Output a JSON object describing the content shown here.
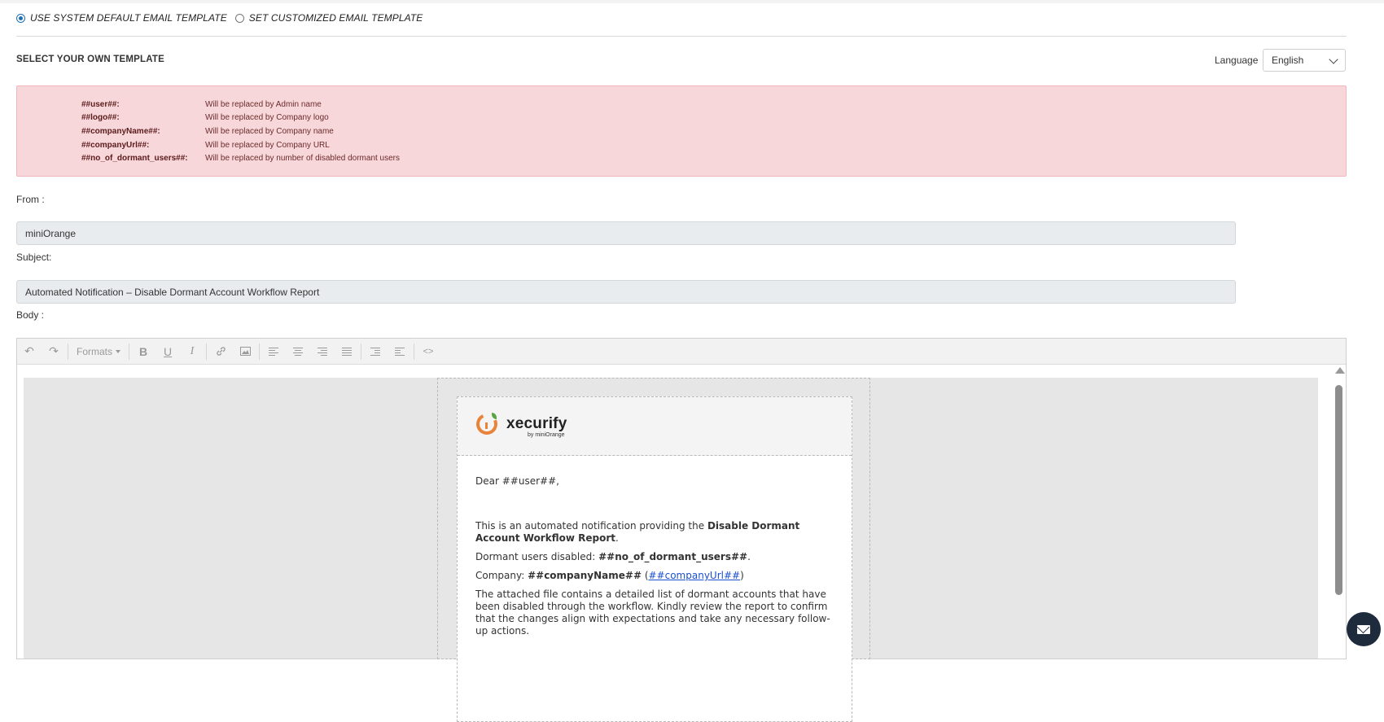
{
  "template_options": {
    "default_label": "USE SYSTEM DEFAULT EMAIL TEMPLATE",
    "custom_label": "SET CUSTOMIZED EMAIL TEMPLATE",
    "selected": "default"
  },
  "section": {
    "title": "SELECT YOUR OWN TEMPLATE",
    "language_label": "Language",
    "language_value": "English"
  },
  "placeholders": [
    {
      "key": "##user##:",
      "desc": "Will be replaced by Admin name"
    },
    {
      "key": "##logo##:",
      "desc": "Will be replaced by Company logo"
    },
    {
      "key": "##companyName##:",
      "desc": "Will be replaced by Company name"
    },
    {
      "key": "##companyUrl##:",
      "desc": "Will be replaced by Company URL"
    },
    {
      "key": "##no_of_dormant_users##:",
      "desc": "Will be replaced by number of disabled dormant users"
    }
  ],
  "form": {
    "from_label": "From :",
    "from_value": "miniOrange",
    "subject_label": "Subject:",
    "subject_value": "Automated Notification – Disable Dormant Account Workflow Report",
    "body_label": "Body :"
  },
  "toolbar": {
    "undo_icon": "undo-icon",
    "redo_icon": "redo-icon",
    "formats_label": "Formats",
    "bold_label": "B",
    "underline_label": "U",
    "italic_label": "I",
    "code_label": "<>"
  },
  "email": {
    "brand": "xecurify",
    "brand_sub": "by miniOrange",
    "greeting": "Dear ##user##,",
    "intro_prefix": "This is an automated notification providing the ",
    "intro_bold": "Disable Dormant Account Workflow Report",
    "intro_suffix": ".",
    "dormant_prefix": "Dormant users disabled: ",
    "dormant_value": "##no_of_dormant_users##",
    "dormant_suffix": ".",
    "company_prefix": "Company: ",
    "company_name": "##companyName##",
    "company_open": " (",
    "company_url": "##companyUrl##",
    "company_close": ")",
    "attached_text": "The attached file contains a detailed list of dormant accounts that have been disabled through the workflow. Kindly review the report to confirm that the changes align with expectations and take any necessary follow-up actions."
  },
  "colors": {
    "alert_bg": "#f8d7da",
    "link": "#1a4fd0",
    "radio_selected": "#1f6fb5",
    "brand_orange": "#e8843a"
  }
}
